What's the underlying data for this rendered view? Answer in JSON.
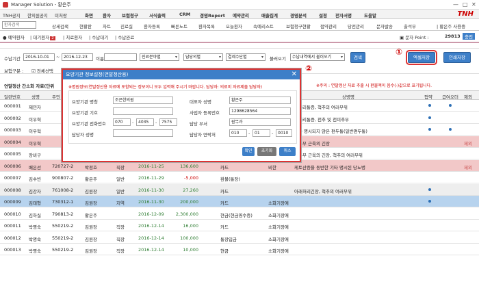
{
  "window": {
    "title": "Manager Solution - 황은주",
    "logo": "TNH"
  },
  "menu": [
    "TNH공지",
    "한의원공지",
    "미처랑",
    "화면",
    "환자",
    "보험청구",
    "서식출력",
    "CRM",
    "경영Report",
    "예약관리",
    "매출집계",
    "경영분석",
    "설정",
    "전자서명",
    "도움말"
  ],
  "toolbar": {
    "search_placeholder": "환자검색",
    "tabs": [
      "상세검색",
      "현황판",
      "차트",
      "진료실",
      "환자등록",
      "빠른노트",
      "환자목록",
      "오늘환자",
      "속예리스트",
      "보험청구현황",
      "접약관리",
      "당전관리",
      "문자발송",
      "출석부"
    ],
    "user": "| 황은주 사용중"
  },
  "tabbar": {
    "tabs": [
      "예약환자",
      "대기환자",
      "치료환자",
      "수납대기",
      "수납완료"
    ],
    "badge": "2",
    "sms_label": "문자 Point :",
    "sms_value": "29813",
    "charge": "충전"
  },
  "filter": {
    "period_label": "수납기간",
    "date_from": "2016-10-01",
    "date_to": "2016-12-23",
    "name_label": "이름",
    "sel1": "진료분야별",
    "sel2": "담당의별",
    "sel3": "결제수단별",
    "load_label": "불러오기",
    "load_sel": "수납내역에서 불러오기",
    "search_btn": "검색",
    "ins_label": "보험구분 :",
    "ins_opt": "전체선택",
    "btn1": "엑셀저장",
    "btn2": "인쇄저장",
    "circle1": "①",
    "circle2": "②"
  },
  "notice": {
    "left": "연말정산 간소화 자료(단위",
    "right": "※주의 : 연말정산 자료 추출 시 환불액이 음수(-)값으로 표기됩니다."
  },
  "table": {
    "headers": [
      "일련번호",
      "성명",
      "주민",
      "상병명",
      "접약",
      "급여오더",
      "제외"
    ],
    "rows": [
      {
        "no": "000001",
        "name": "제민자",
        "d": "",
        "dr": "",
        "k": "",
        "dt": "",
        "amt": "",
        "pay": "",
        "note": "",
        "dx": "캐허리통증, 척추의 여러부위",
        "e1": true,
        "e2": true,
        "ex": "",
        "cls": ""
      },
      {
        "no": "000002",
        "name": "이우혁",
        "d": "",
        "dr": "",
        "k": "",
        "dt": "",
        "amt": "",
        "pay": "",
        "note": "",
        "dx": "캐허리통증, 천추 및 천미추부",
        "e1": true,
        "e2": false,
        "ex": "",
        "cls": ""
      },
      {
        "no": "000003",
        "name": "이우혁",
        "d": "",
        "dr": "",
        "k": "",
        "dt": "",
        "amt": "",
        "pay": "",
        "note": "",
        "dx": "기타 명시되지 않은 편두통(일반편두통)",
        "e1": true,
        "e2": true,
        "ex": "",
        "cls": ""
      },
      {
        "no": "000004",
        "name": "이우혁",
        "d": "",
        "dr": "",
        "k": "",
        "dt": "",
        "amt": "",
        "pay": "",
        "note": "",
        "dx": "요추부 근육의 긴장",
        "e1": false,
        "e2": false,
        "ex": "제외",
        "cls": "pink"
      },
      {
        "no": "000005",
        "name": "장비구",
        "d": "",
        "dr": "",
        "k": "",
        "dt": "",
        "amt": "",
        "pay": "",
        "note": "",
        "dx": "요추부 근육의 긴장, 척추의 여러부위",
        "e1": false,
        "e2": false,
        "ex": "",
        "cls": ""
      },
      {
        "no": "000006",
        "name": "배은선",
        "d": "720727-2",
        "dr": "박정호",
        "k": "직장",
        "dt": "2016-11-25",
        "amt": "136,600",
        "pay": "카드",
        "note": "비한",
        "dx": "케토산증을 동반한 기타 명시된 당뇨병",
        "e1": false,
        "e2": false,
        "ex": "제외",
        "cls": "pink"
      },
      {
        "no": "000007",
        "name": "김수빈",
        "d": "900807-2",
        "dr": "황은주",
        "k": "일반",
        "dt": "2016-11-29",
        "amt": "-5,000",
        "pay": "환불(통장)",
        "note": "",
        "dx": "",
        "e1": false,
        "e2": false,
        "ex": "",
        "cls": ""
      },
      {
        "no": "000008",
        "name": "김강자",
        "d": "761008-2",
        "dr": "김원장",
        "k": "일반",
        "dt": "2016-11-30",
        "amt": "27,260",
        "pay": "카드",
        "note": "",
        "dx": "아래허리긴장, 척추의 여러부위",
        "e1": true,
        "e2": false,
        "ex": "",
        "cls": "gray"
      },
      {
        "no": "000009",
        "name": "김태형",
        "d": "730312-1",
        "dr": "김원장",
        "k": "지역",
        "dt": "2016-11-30",
        "amt": "200,000",
        "pay": "카드",
        "note": "소화기장애",
        "dx": "",
        "e1": true,
        "e2": false,
        "ex": "",
        "cls": "blue"
      },
      {
        "no": "000010",
        "name": "김하실",
        "d": "790813-2",
        "dr": "황은주",
        "k": "",
        "dt": "2016-12-09",
        "amt": "2,300,000",
        "pay": "현금(현금영수증)",
        "note": "소화기장애",
        "dx": "",
        "e1": false,
        "e2": false,
        "ex": "",
        "cls": ""
      },
      {
        "no": "000011",
        "name": "박명숙",
        "d": "550219-2",
        "dr": "김원장",
        "k": "직장",
        "dt": "2016-12-14",
        "amt": "16,000",
        "pay": "카드",
        "note": "소화기장애",
        "dx": "",
        "e1": false,
        "e2": false,
        "ex": "",
        "cls": ""
      },
      {
        "no": "000012",
        "name": "박명숙",
        "d": "550219-2",
        "dr": "김원장",
        "k": "직장",
        "dt": "2016-12-14",
        "amt": "100,000",
        "pay": "통장입금",
        "note": "소화기장애",
        "dx": "",
        "e1": false,
        "e2": false,
        "ex": "",
        "cls": ""
      },
      {
        "no": "000013",
        "name": "박명숙",
        "d": "550219-2",
        "dr": "김원장",
        "k": "직장",
        "dt": "2016-12-14",
        "amt": "10,000",
        "pay": "현금",
        "note": "소화기장애",
        "dx": "",
        "e1": false,
        "e2": false,
        "ex": "",
        "cls": ""
      }
    ]
  },
  "modal": {
    "title": "요양기관 정보설정(연말정산용)",
    "note": "※병원정보(연말정산용 자료에 포함되는 정보이니 모두 입력해 주시기 바랍니다. 담당자: 의료비 자료제출 담당자)",
    "l1": "요양기관 명칭",
    "v1": "조은한의원",
    "l2": "요양기관 기호",
    "v2": "",
    "l3": "요양기관 전화번호",
    "p1": "070",
    "p2": "4035",
    "p3": "7575",
    "l4": "담당자 성명",
    "v4": "",
    "r1": "대표자 성명",
    "rv1": "황은주",
    "r2": "사업자 등록번호",
    "rv2": "1298628564",
    "r3": "담당 부서",
    "rv3": "원무과",
    "r4": "담당자 연락처",
    "q1": "010",
    "q2": "01",
    "q3": "0010",
    "b1": "확인",
    "b2": "초기화",
    "b3": "취소"
  }
}
